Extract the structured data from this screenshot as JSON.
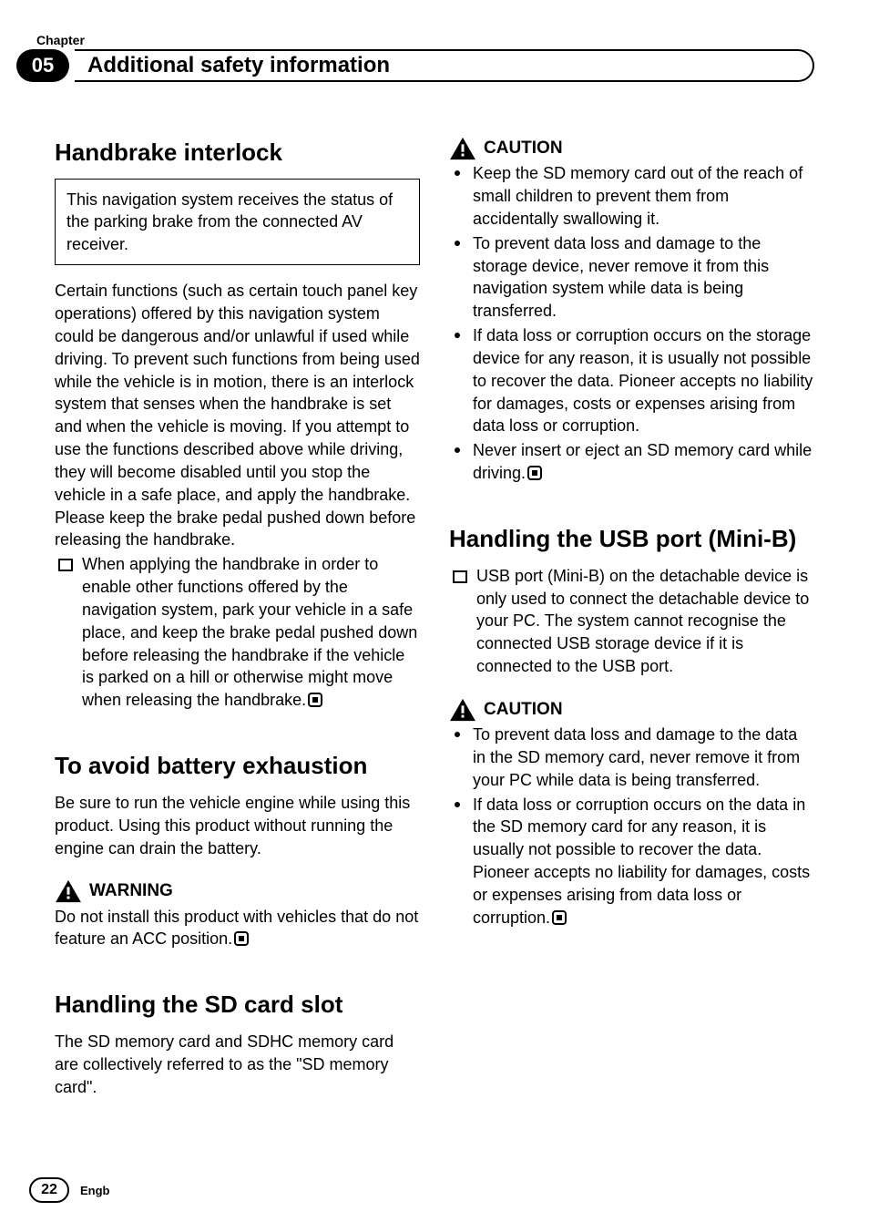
{
  "header": {
    "chapter_label": "Chapter",
    "chapter_number": "05",
    "title": "Additional safety information"
  },
  "left": {
    "h1": "Handbrake interlock",
    "note_box": "This navigation system receives the status of the parking brake from the connected AV receiver.",
    "para1": "Certain functions (such as certain touch panel key operations) offered by this navigation system could be dangerous and/or unlawful if used while driving. To prevent such functions from being used while the vehicle is in motion, there is an interlock system that senses when the handbrake is set and when the vehicle is moving. If you attempt to use the functions described above while driving, they will become disabled until you stop the vehicle in a safe place, and apply the handbrake. Please keep the brake pedal pushed down before releasing the handbrake.",
    "bullet1": "When applying the handbrake in order to enable other functions offered by the navigation system, park your vehicle in a safe place, and keep the brake pedal pushed down before releasing the handbrake if the vehicle is parked on a hill or otherwise might move when releasing the handbrake.",
    "h2": "To avoid battery exhaustion",
    "para2": "Be sure to run the vehicle engine while using this product. Using this product without running the engine can drain the battery.",
    "warning_label": "WARNING",
    "warning_text": "Do not install this product with vehicles that do not feature an ACC position.",
    "h3": "Handling the SD card slot",
    "para3": "The SD memory card and SDHC memory card are collectively referred to as the \"SD memory card\"."
  },
  "right": {
    "caution1_label": "CAUTION",
    "c1_items": [
      "Keep the SD memory card out of the reach of small children to prevent them from accidentally swallowing it.",
      "To prevent data loss and damage to the storage device, never remove it from this navigation system while data is being transferred.",
      "If data loss or corruption occurs on the storage device for any reason, it is usually not possible to recover the data. Pioneer accepts no liability for damages, costs or expenses arising from data loss or corruption.",
      "Never insert or eject an SD memory card while driving."
    ],
    "h1": "Handling the USB port (Mini-B)",
    "usb_bullet": "USB port (Mini-B) on the detachable device is only used to connect the detachable device to your PC. The system cannot recognise the connected USB storage device if it is connected to the USB port.",
    "caution2_label": "CAUTION",
    "c2_items": [
      "To prevent data loss and damage to the data in the SD memory card, never remove it from your PC while data is being transferred.",
      "If data loss or corruption occurs on the data in the SD memory card for any reason, it is usually not possible to recover the data. Pioneer accepts no liability for damages, costs or expenses arising from data loss or corruption."
    ]
  },
  "footer": {
    "page": "22",
    "lang": "Engb"
  }
}
